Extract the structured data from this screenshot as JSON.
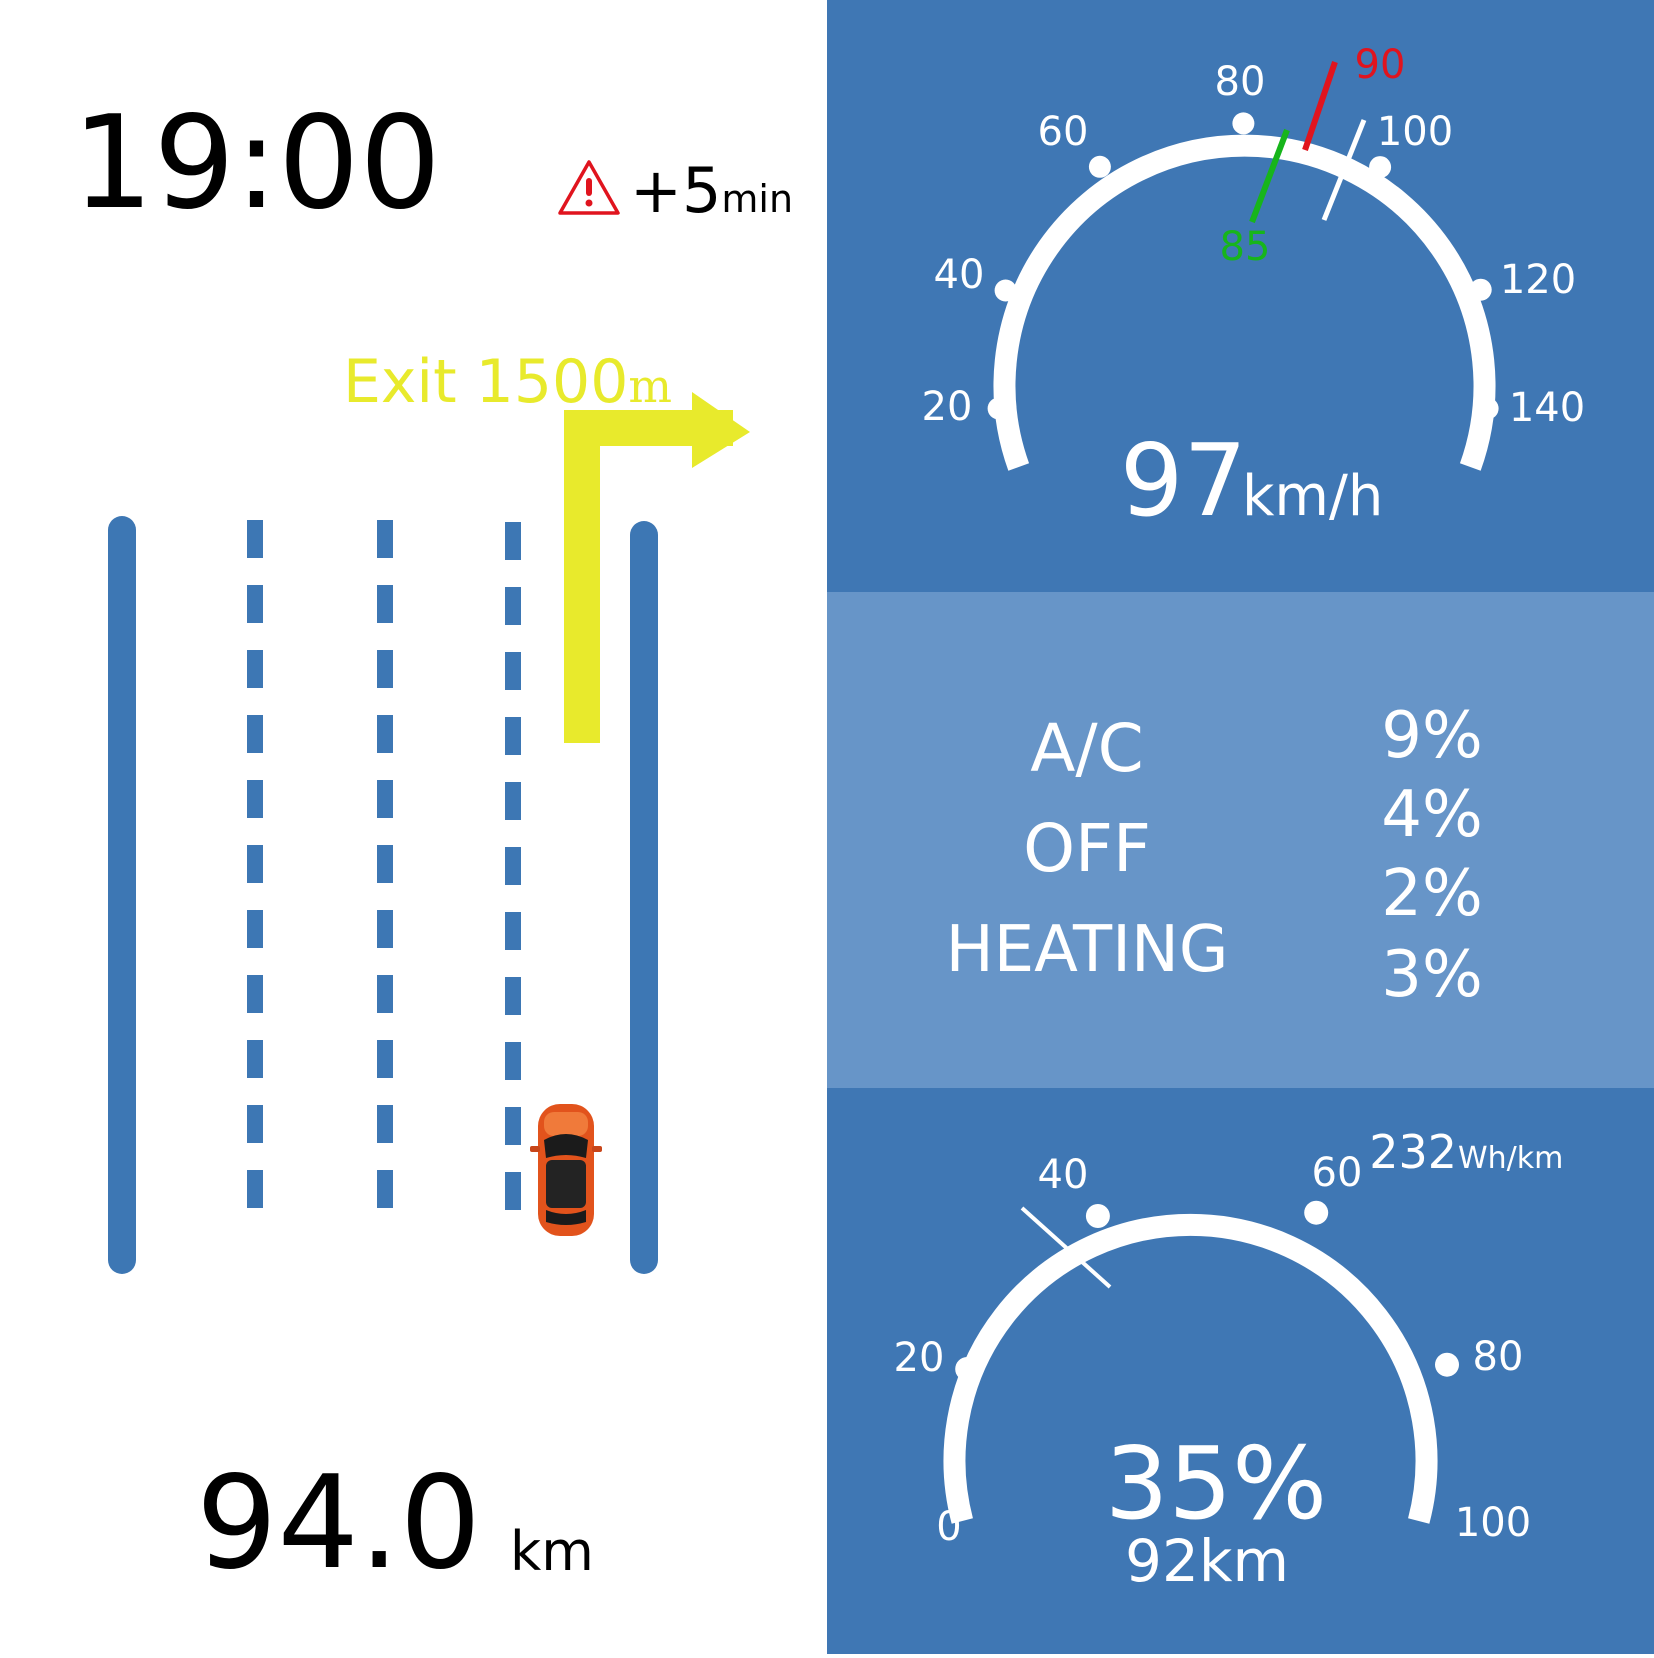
{
  "navigation": {
    "clock": "19:00",
    "delay_value": "+5",
    "delay_unit": "min",
    "exit_label": "Exit 1500",
    "exit_unit": "m",
    "distance_value": "94.0",
    "distance_unit": "km",
    "warning_icon": "warning-triangle-icon",
    "vehicle_icon": "car-icon",
    "lane_count": 4,
    "current_lane": 4
  },
  "speedometer": {
    "ticks": [
      "20",
      "40",
      "60",
      "80",
      "100",
      "120",
      "140"
    ],
    "speed_value": "97",
    "speed_unit": "km/h",
    "marker_low": "85",
    "marker_high": "90",
    "marker_low_color": "#17b51b",
    "marker_high_color": "#e0141e"
  },
  "climate": {
    "modes": [
      "A/C",
      "OFF",
      "HEATING"
    ],
    "selected_mode": "A/C",
    "percentages": [
      "9%",
      "4%",
      "2%",
      "3%"
    ]
  },
  "battery": {
    "ticks": [
      "0",
      "20",
      "40",
      "60",
      "80",
      "100"
    ],
    "charge_value": "35%",
    "range_value": "92km",
    "consumption_value": "232",
    "consumption_unit": "Wh/km"
  },
  "colors": {
    "panel_blue": "#3f77b4",
    "panel_light_blue": "#6795c8",
    "lane_blue": "#3d77b4",
    "route_yellow": "#e8ea2c",
    "warning_red": "#e0141e"
  }
}
